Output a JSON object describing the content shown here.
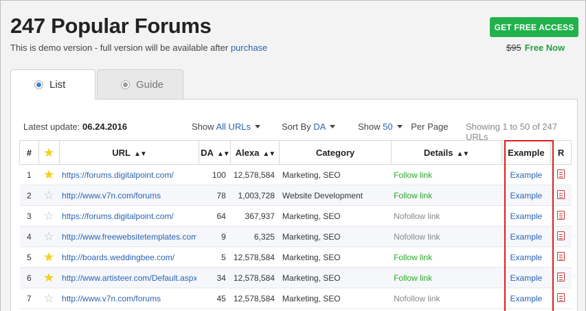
{
  "header": {
    "title": "247 Popular Forums",
    "subtitle_prefix": "This is demo version - full version will be available after ",
    "subtitle_link": "purchase",
    "cta_label": "GET FREE ACCESS",
    "old_price": "$95",
    "free_label": "Free Now"
  },
  "tabs": [
    {
      "label": "List",
      "active": true
    },
    {
      "label": "Guide",
      "active": false
    }
  ],
  "toolbar": {
    "latest_label": "Latest update:",
    "latest_date": "06.24.2016",
    "show_label": "Show",
    "show_value": "All URLs",
    "sort_label": "Sort By",
    "sort_value": "DA",
    "count_label": "Show",
    "count_value": "50",
    "per_page": "Per Page",
    "showing": "Showing 1 to 50 of 247 URLs"
  },
  "columns": [
    "#",
    "",
    "URL",
    "DA",
    "Alexa",
    "Category",
    "Details",
    "Example",
    "R"
  ],
  "rows": [
    {
      "n": "1",
      "starred": true,
      "url": "https://forums.digitalpoint.com/",
      "da": "100",
      "alexa": "12,578,584",
      "category": "Marketing, SEO",
      "details": "Follow link",
      "follow": true,
      "example": "Example"
    },
    {
      "n": "2",
      "starred": false,
      "url": "http://www.v7n.com/forums",
      "da": "78",
      "alexa": "1,003,728",
      "category": "Website Development",
      "details": "Follow link",
      "follow": true,
      "example": "Example"
    },
    {
      "n": "3",
      "starred": false,
      "url": "https://forums.digitalpoint.com/",
      "da": "64",
      "alexa": "367,937",
      "category": "Marketing, SEO",
      "details": "Nofollow link",
      "follow": false,
      "example": "Example"
    },
    {
      "n": "4",
      "starred": false,
      "url": "http://www.freewebsitetemplates.com/",
      "da": "9",
      "alexa": "6,325",
      "category": "Marketing, SEO",
      "details": "Nofollow link",
      "follow": false,
      "example": "Example"
    },
    {
      "n": "5",
      "starred": true,
      "url": "http://boards.weddingbee.com/",
      "da": "5",
      "alexa": "12,578,584",
      "category": "Marketing, SEO",
      "details": "Follow link",
      "follow": true,
      "example": "Example"
    },
    {
      "n": "6",
      "starred": true,
      "url": "http://www.artisteer.com/Default.aspx?",
      "da": "34",
      "alexa": "12,578,584",
      "category": "Marketing, SEO",
      "details": "Follow link",
      "follow": true,
      "example": "Example"
    },
    {
      "n": "7",
      "starred": false,
      "url": "http://www.v7n.com/forums",
      "da": "45",
      "alexa": "12,578,584",
      "category": "Marketing, SEO",
      "details": "Nofollow link",
      "follow": false,
      "example": "Example"
    }
  ]
}
